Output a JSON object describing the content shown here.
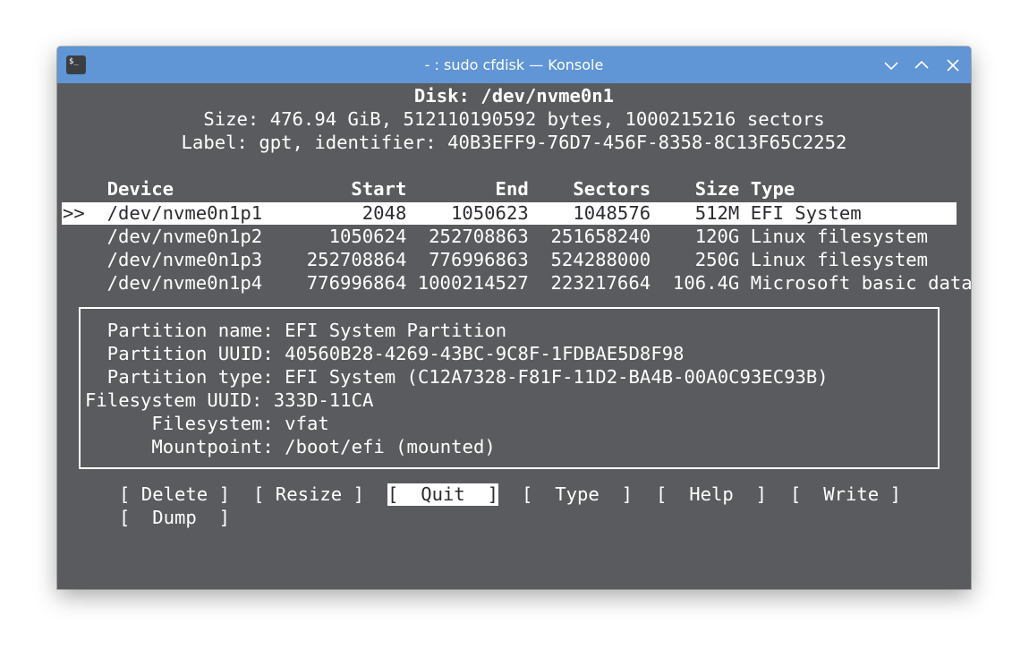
{
  "window": {
    "title": "- : sudo cfdisk — Konsole",
    "app_icon_glyph": "$_",
    "buttons": [
      "minimize",
      "maximize",
      "close"
    ]
  },
  "disk": {
    "title": "Disk: /dev/nvme0n1",
    "size_line": "Size: 476.94 GiB, 512110190592 bytes, 1000215216 sectors",
    "label_line": "Label: gpt, identifier: 40B3EFF9-76D7-456F-8358-8C13F65C2252"
  },
  "table": {
    "header": "    Device                Start        End    Sectors    Size Type",
    "cursor": ">>",
    "rows": [
      {
        "text": "    /dev/nvme0n1p1         2048    1050623    1048576    512M EFI System",
        "selected": true
      },
      {
        "text": "    /dev/nvme0n1p2      1050624  252708863  251658240    120G Linux filesystem",
        "selected": false
      },
      {
        "text": "    /dev/nvme0n1p3    252708864  776996863  524288000    250G Linux filesystem",
        "selected": false
      },
      {
        "text": "    /dev/nvme0n1p4    776996864 1000214527  223217664  106.4G Microsoft basic data",
        "selected": false
      }
    ]
  },
  "info": {
    "lines": [
      "  Partition name: EFI System Partition",
      "  Partition UUID: 40560B28-4269-43BC-9C8F-1FDBAE5D8F98",
      "  Partition type: EFI System (C12A7328-F81F-11D2-BA4B-00A0C93EC93B)",
      "Filesystem UUID: 333D-11CA",
      "      Filesystem: vfat",
      "      Mountpoint: /boot/efi (mounted)"
    ]
  },
  "menu": {
    "buttons": [
      {
        "label": "[ Delete ]",
        "active": false
      },
      {
        "label": "[ Resize ]",
        "active": false
      },
      {
        "label": "[  Quit  ]",
        "active": true
      },
      {
        "label": "[  Type  ]",
        "active": false
      },
      {
        "label": "[  Help  ]",
        "active": false
      },
      {
        "label": "[  Write ]",
        "active": false
      },
      {
        "label": "[  Dump  ]",
        "active": false
      }
    ]
  },
  "colors": {
    "titlebar": "#6095d6",
    "terminal_bg": "#5a5b5e",
    "terminal_fg": "#ffffff",
    "selection_fg": "#2c2d30"
  }
}
